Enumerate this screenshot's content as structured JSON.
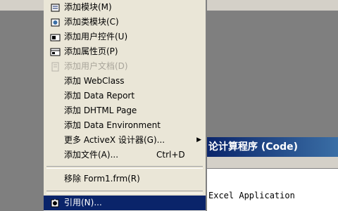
{
  "menu": {
    "items": [
      {
        "label": "添加模块(M)",
        "icon": "module-icon",
        "disabled": false,
        "selected": false
      },
      {
        "label": "添加类模块(C)",
        "icon": "class-module-icon",
        "disabled": false,
        "selected": false
      },
      {
        "label": "添加用户控件(U)",
        "icon": "user-control-icon",
        "disabled": false,
        "selected": false
      },
      {
        "label": "添加属性页(P)",
        "icon": "property-page-icon",
        "disabled": false,
        "selected": false
      },
      {
        "label": "添加用户文档(D)",
        "icon": "user-document-icon",
        "disabled": true,
        "selected": false
      },
      {
        "label": "添加 WebClass",
        "icon": "",
        "disabled": false,
        "selected": false
      },
      {
        "label": "添加 Data Report",
        "icon": "",
        "disabled": false,
        "selected": false
      },
      {
        "label": "添加 DHTML Page",
        "icon": "",
        "disabled": false,
        "selected": false
      },
      {
        "label": "添加 Data Environment",
        "icon": "",
        "disabled": false,
        "selected": false
      },
      {
        "label": "更多 ActiveX 设计器(G)...",
        "icon": "",
        "disabled": false,
        "selected": false,
        "submenu": true
      },
      {
        "label": "添加文件(A)...",
        "shortcut": "Ctrl+D",
        "icon": "",
        "disabled": false,
        "selected": false
      },
      {
        "label": "移除 Form1.frm(R)",
        "icon": "",
        "disabled": false,
        "selected": false
      },
      {
        "label": "引用(N)...",
        "icon": "references-icon",
        "disabled": false,
        "selected": true
      }
    ]
  },
  "background": {
    "window_title": "论计算程序 (Code)",
    "code_line": "Excel Application"
  },
  "colors": {
    "menu_bg": "#eae6d7",
    "highlight": "#0a246a",
    "titlebar": "#0a246a",
    "disabled_text": "#a8a49a"
  }
}
